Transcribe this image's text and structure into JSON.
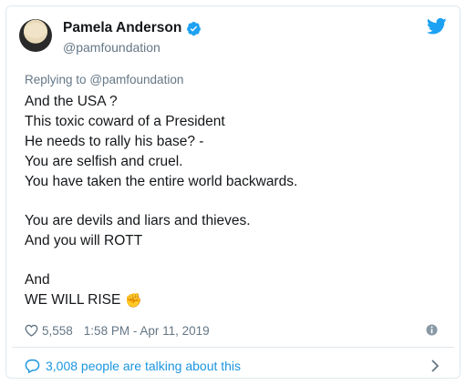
{
  "tweet": {
    "author_name": "Pamela Anderson",
    "author_handle": "@pamfoundation",
    "replying_prefix": "Replying to",
    "replying_to": "@pamfoundation",
    "lines": [
      "And the USA ?",
      "This toxic coward of a President",
      "He needs to rally his base? -",
      "You are selfish and cruel.",
      "You have taken the entire world backwards.",
      "",
      "You are devils and liars and thieves.",
      "And you will ROTT",
      "",
      "And",
      "WE WILL RISE"
    ],
    "fist_emoji": "✊",
    "likes": "5,558",
    "timestamp": "1:58 PM - Apr 11, 2019",
    "talking": "3,008 people are talking about this"
  },
  "icons": {
    "verified": "verified-badge-icon",
    "twitter": "twitter-bird-icon",
    "heart": "heart-icon",
    "info": "info-icon",
    "speech": "speech-bubble-icon",
    "chevron": "chevron-right-icon"
  },
  "colors": {
    "accent": "#1da1f2",
    "link": "#1b95e0",
    "muted": "#657786",
    "text": "#14171a",
    "border": "#e1e8ed"
  }
}
